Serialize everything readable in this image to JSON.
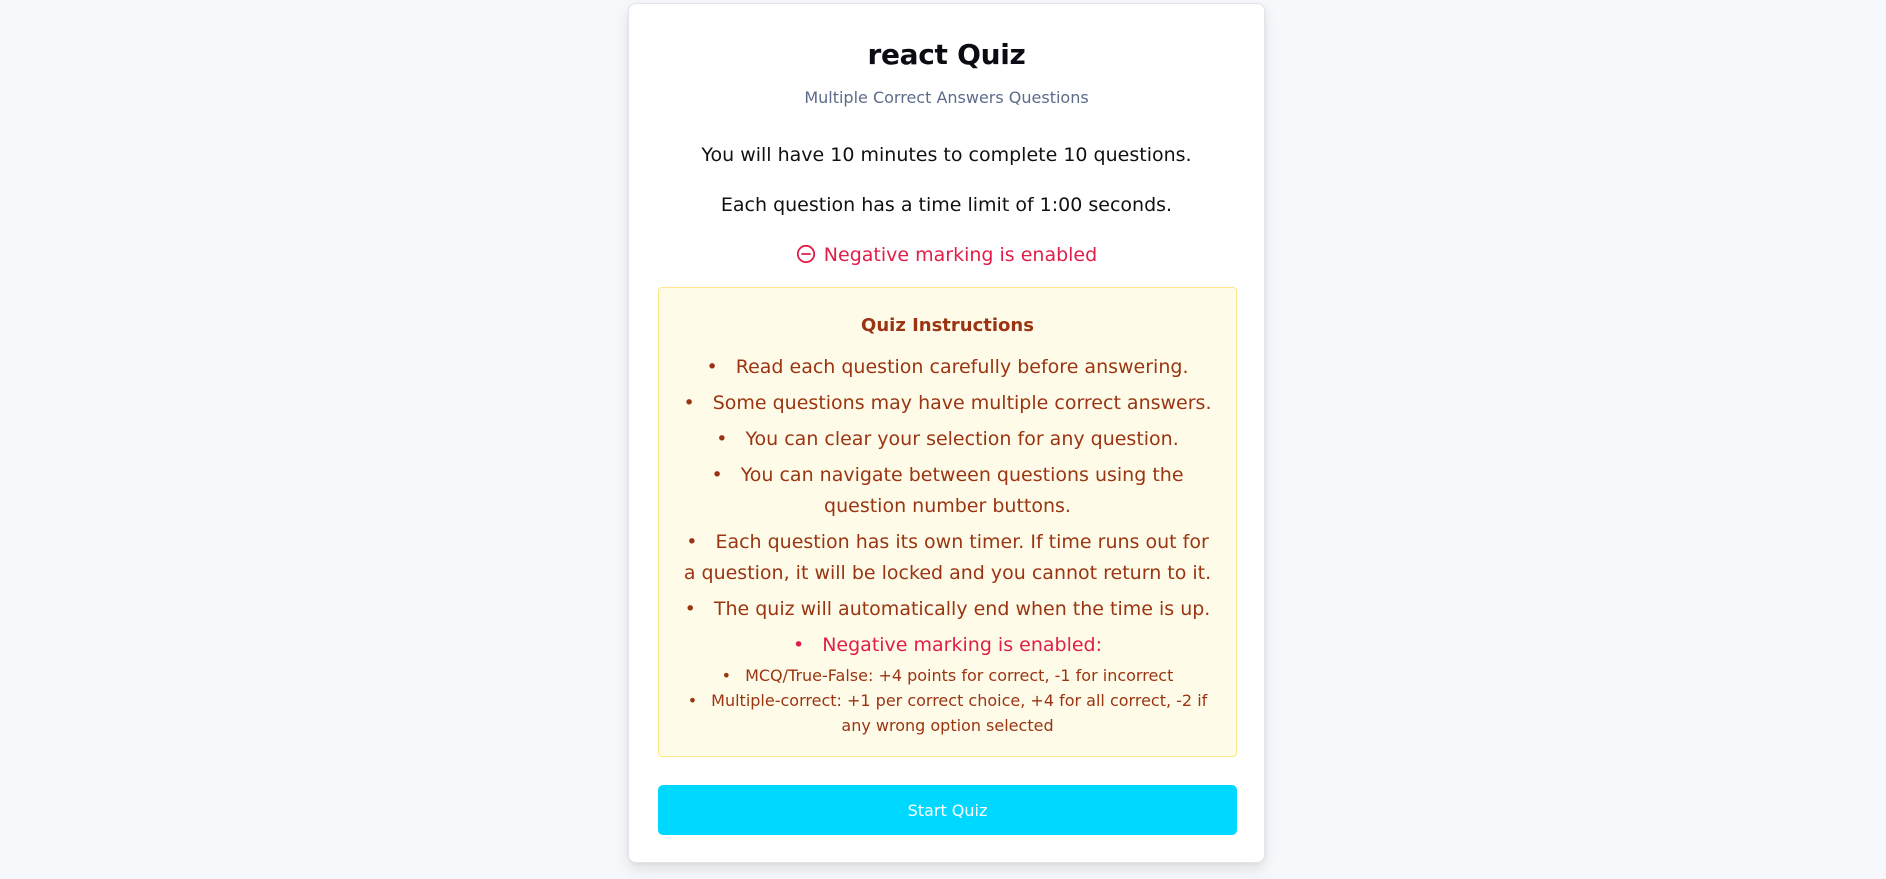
{
  "quiz": {
    "title": "react Quiz",
    "subtitle": "Multiple Correct Answers Questions",
    "duration_text": "You will have 10 minutes to complete 10 questions.",
    "time_limit_text": "Each question has a time limit of 1:00 seconds.",
    "negative_marking_text": "Negative marking is enabled",
    "negative_icon": "minus-circle-icon"
  },
  "instructions": {
    "heading": "Quiz Instructions",
    "rules": [
      "Read each question carefully before answering.",
      "Some questions may have multiple correct answers.",
      "You can clear your selection for any question.",
      "You can navigate between questions using the question number buttons.",
      "Each question has its own timer. If time runs out for a question, it will be locked and you cannot return to it.",
      "The quiz will automatically end when the time is up."
    ],
    "negative_rule": "Negative marking is enabled:",
    "scoring": [
      "MCQ/True-False: +4 points for correct, -1 for incorrect",
      "Multiple-correct: +1 per correct choice, +4 for all correct, -2 if any wrong option selected"
    ]
  },
  "actions": {
    "start_label": "Start Quiz"
  },
  "colors": {
    "accent": "#00d8ff",
    "negative": "#e11d48",
    "instruction_text": "#9a3412",
    "instruction_bg": "#fefce8"
  }
}
